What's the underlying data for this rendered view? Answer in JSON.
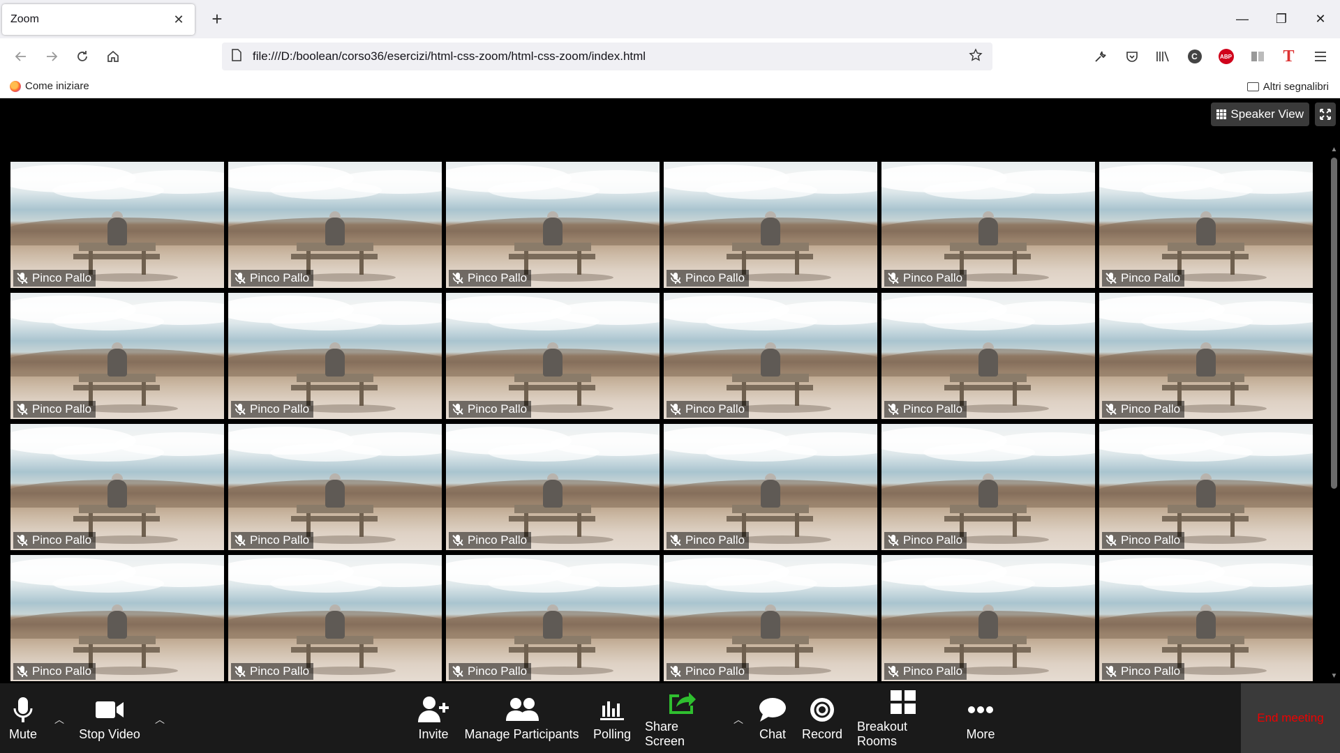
{
  "browser": {
    "tab_title": "Zoom",
    "tab_close": "✕",
    "new_tab": "+",
    "url": "file:///D:/boolean/corso36/esercizi/html-css-zoom/html-css-zoom/index.html",
    "bookmark_left": "Come iniziare",
    "bookmark_right": "Altri segnalibri",
    "win_minimize": "—",
    "win_restore": "❐",
    "win_close": "✕"
  },
  "zoom": {
    "speaker_view_label": "Speaker View",
    "participants": [
      "Pinco Pallo",
      "Pinco Pallo",
      "Pinco Pallo",
      "Pinco Pallo",
      "Pinco Pallo",
      "Pinco Pallo",
      "Pinco Pallo",
      "Pinco Pallo",
      "Pinco Pallo",
      "Pinco Pallo",
      "Pinco Pallo",
      "Pinco Pallo",
      "Pinco Pallo",
      "Pinco Pallo",
      "Pinco Pallo",
      "Pinco Pallo",
      "Pinco Pallo",
      "Pinco Pallo",
      "Pinco Pallo",
      "Pinco Pallo",
      "Pinco Pallo",
      "Pinco Pallo",
      "Pinco Pallo",
      "Pinco Pallo"
    ],
    "controls": {
      "mute": "Mute",
      "stop_video": "Stop Video",
      "invite": "Invite",
      "manage_participants": "Manage Participants",
      "polling": "Polling",
      "share_screen": "Share Screen",
      "chat": "Chat",
      "record": "Record",
      "breakout_rooms": "Breakout Rooms",
      "more": "More",
      "end_meeting": "End meeting"
    }
  },
  "colors": {
    "share_screen_green": "#2fbf2f",
    "end_meeting_red": "#ee0000",
    "abp_red": "#d0021b"
  }
}
